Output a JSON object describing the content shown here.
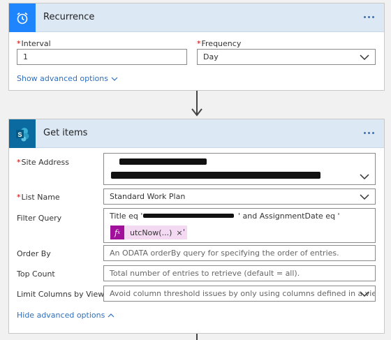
{
  "recurrence": {
    "title": "Recurrence",
    "interval_label": "Interval",
    "interval_value": "1",
    "frequency_label": "Frequency",
    "frequency_value": "Day",
    "show_advanced": "Show advanced options"
  },
  "get_items": {
    "title": "Get items",
    "site_address_label": "Site Address",
    "list_name_label": "List Name",
    "list_name_value": "Standard Work Plan",
    "filter_query_label": "Filter Query",
    "filter_query_prefix": "Title eq '",
    "filter_query_mid": "' and AssignmentDate eq '",
    "filter_token": "utcNow(...)",
    "filter_token_close": "×",
    "filter_query_suffix": "'",
    "order_by_label": "Order By",
    "order_by_placeholder": "An ODATA orderBy query for specifying the order of entries.",
    "top_count_label": "Top Count",
    "top_count_placeholder": "Total number of entries to retrieve (default = all).",
    "limit_columns_label": "Limit Columns by View",
    "limit_columns_placeholder": "Avoid column threshold issues by only using columns defined in a view",
    "hide_advanced": "Hide advanced options"
  },
  "colors": {
    "accent": "#1f85ff",
    "sharepoint": "#0b6a9f",
    "link": "#2f6fbc",
    "required": "#c60000",
    "token": "#a0109a"
  },
  "icons": [
    "alarm-clock-icon",
    "sharepoint-icon",
    "more-options-icon",
    "chevron-down-icon",
    "chevron-up-icon",
    "function-icon",
    "close-icon",
    "arrow-down-icon"
  ]
}
